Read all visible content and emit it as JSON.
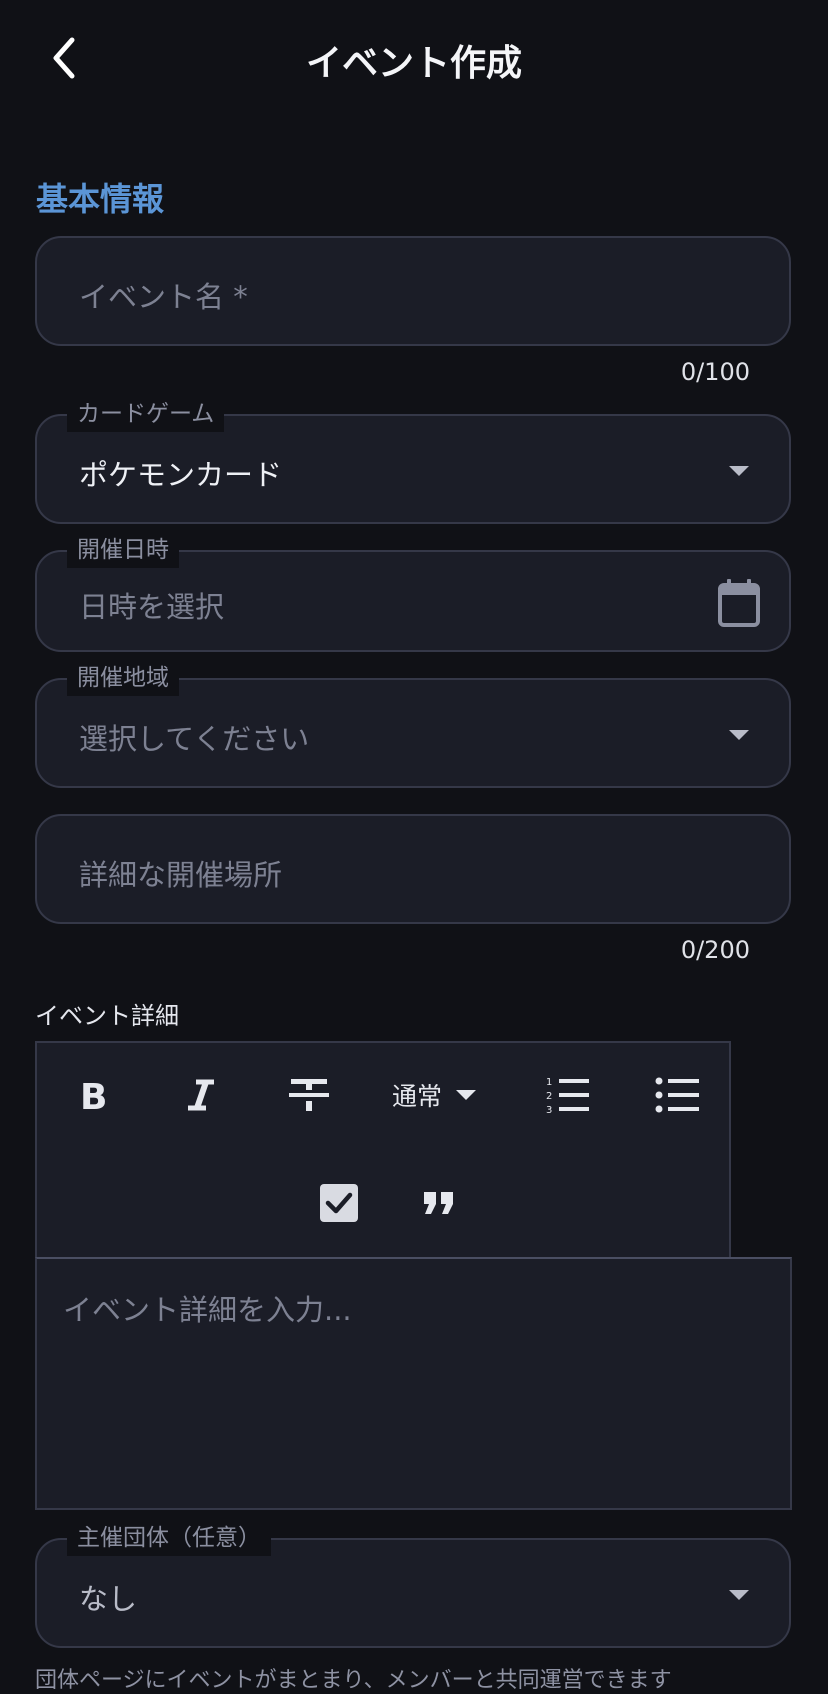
{
  "header": {
    "title": "イベント作成"
  },
  "section": {
    "title": "基本情報"
  },
  "event_name": {
    "placeholder": "イベント名 *",
    "counter": "0/100"
  },
  "card_game": {
    "label": "カードゲーム",
    "value": "ポケモンカード"
  },
  "datetime": {
    "label": "開催日時",
    "placeholder": "日時を選択"
  },
  "region": {
    "label": "開催地域",
    "placeholder": "選択してください"
  },
  "venue": {
    "placeholder": "詳細な開催場所",
    "counter": "0/200"
  },
  "details": {
    "label": "イベント詳細",
    "heading_select": "通常",
    "placeholder": "イベント詳細を入力..."
  },
  "organizer": {
    "label": "主催団体（任意）",
    "value": "なし",
    "helper": "団体ページにイベントがまとまり、メンバーと共同運営できます"
  },
  "icons": {
    "back": "chevron-left-icon",
    "calendar": "calendar-icon",
    "bold": "bold-icon",
    "italic": "italic-icon",
    "strike": "strikethrough-icon",
    "ordered_list": "ordered-list-icon",
    "bullet_list": "bullet-list-icon",
    "checklist": "checkbox-icon",
    "quote": "quote-icon"
  },
  "colors": {
    "background": "#101116",
    "field": "#1b1d27",
    "border": "#353848",
    "accent": "#5b95d6"
  }
}
